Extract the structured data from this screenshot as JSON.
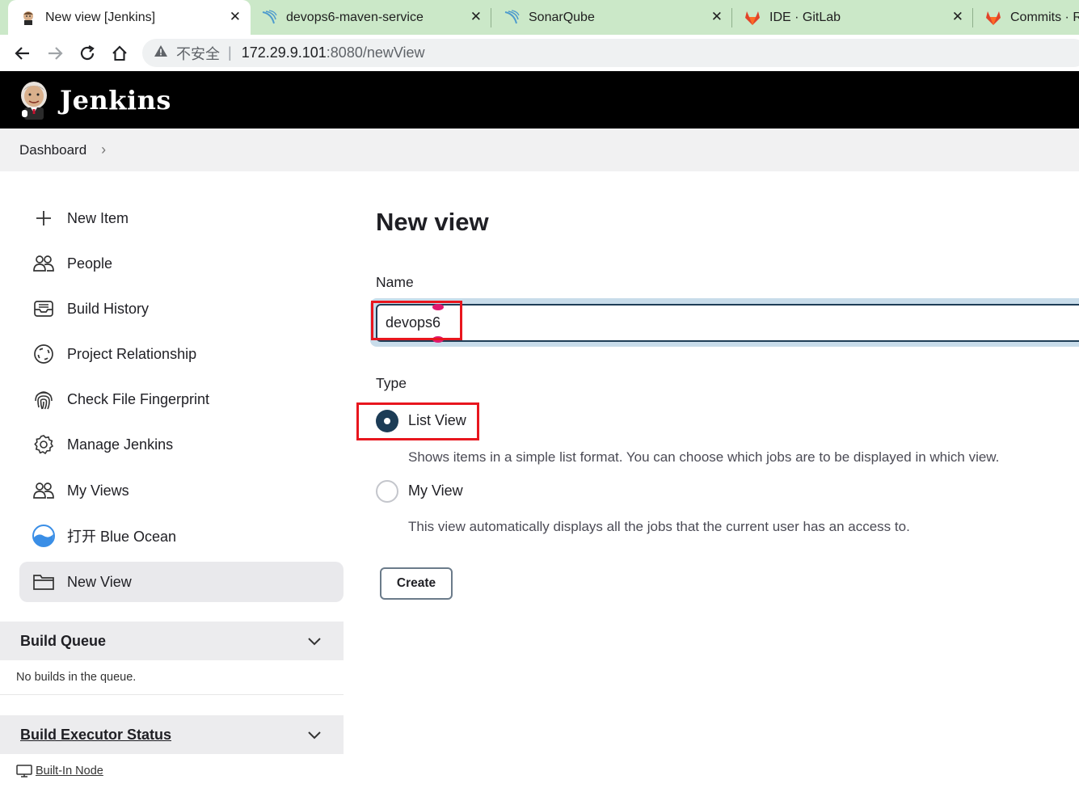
{
  "browser": {
    "tabs": [
      {
        "title": "New view [Jenkins]",
        "icon": "jenkins-favicon",
        "active": true
      },
      {
        "title": "devops6-maven-service",
        "icon": "sonarqube-favicon"
      },
      {
        "title": "SonarQube",
        "icon": "sonarqube-favicon"
      },
      {
        "title": "IDE · GitLab",
        "icon": "gitlab-favicon"
      },
      {
        "title": "Commits · R",
        "icon": "gitlab-favicon"
      }
    ],
    "close_glyph": "✕",
    "address": {
      "security_label": "不安全",
      "separator": "|",
      "host": "172.29.9.101",
      "path": ":8080/newView"
    }
  },
  "header": {
    "brand": "Jenkins"
  },
  "breadcrumb": {
    "items": [
      "Dashboard"
    ],
    "chevron": "›"
  },
  "sidebar": {
    "tasks": [
      {
        "label": "New Item",
        "icon": "plus-icon"
      },
      {
        "label": "People",
        "icon": "people-icon"
      },
      {
        "label": "Build History",
        "icon": "inbox-icon"
      },
      {
        "label": "Project Relationship",
        "icon": "relationship-icon"
      },
      {
        "label": "Check File Fingerprint",
        "icon": "fingerprint-icon"
      },
      {
        "label": "Manage Jenkins",
        "icon": "gear-icon"
      },
      {
        "label": "My Views",
        "icon": "people-icon"
      },
      {
        "label": "打开 Blue Ocean",
        "icon": "blue-ocean-icon"
      },
      {
        "label": "New View",
        "icon": "folder-icon",
        "selected": true
      }
    ],
    "build_queue": {
      "title": "Build Queue",
      "empty_text": "No builds in the queue."
    },
    "executor_status": {
      "title": "Build Executor Status",
      "node": "Built-In Node"
    }
  },
  "main": {
    "title": "New view",
    "name_label": "Name",
    "name_value": "devops6",
    "type_label": "Type",
    "options": [
      {
        "label": "List View",
        "description": "Shows items in a simple list format. You can choose which jobs are to be displayed in which view.",
        "checked": true
      },
      {
        "label": "My View",
        "description": "This view automatically displays all the jobs that the current user has an access to.",
        "checked": false
      }
    ],
    "create_label": "Create"
  },
  "colors": {
    "tabbar": "#cbe8c8",
    "header": "#000000",
    "accent": "#1c3c56",
    "highlight_box": "#e8161e"
  }
}
